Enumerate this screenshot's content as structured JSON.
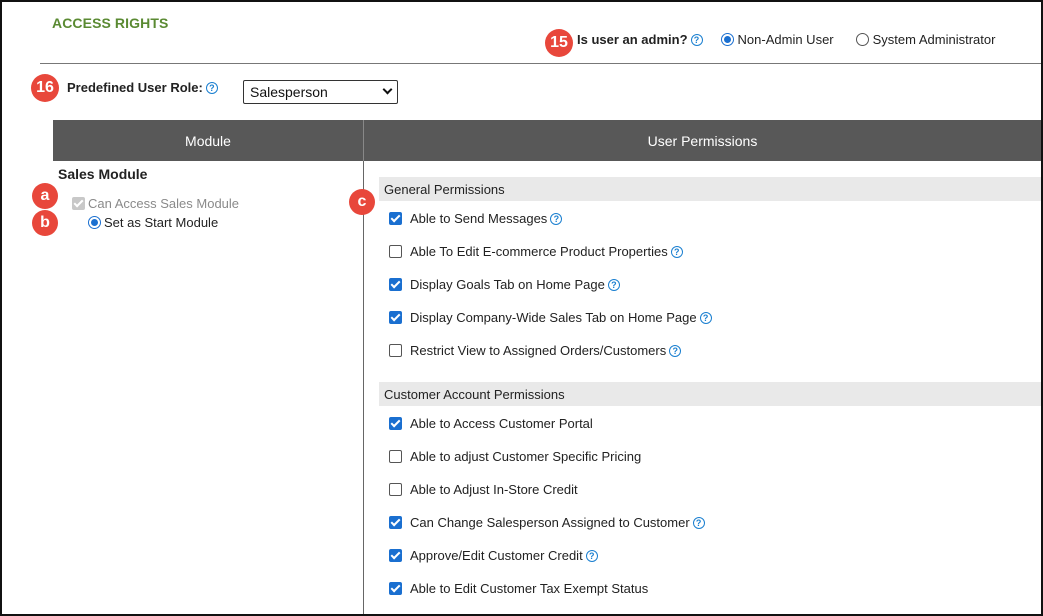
{
  "section_title": "ACCESS RIGHTS",
  "badges": {
    "admin": "15",
    "role": "16",
    "can_access": "a",
    "start_module": "b",
    "permissions": "c"
  },
  "admin": {
    "label": "Is user an admin?",
    "options": [
      {
        "label": "Non-Admin User",
        "selected": true
      },
      {
        "label": "System Administrator",
        "selected": false
      }
    ]
  },
  "role": {
    "label": "Predefined User Role:",
    "selected": "Salesperson"
  },
  "table": {
    "module_header": "Module",
    "permissions_header": "User Permissions"
  },
  "module": {
    "name": "Sales Module",
    "can_access": {
      "label": "Can Access Sales Module",
      "checked": true,
      "disabled": true
    },
    "start_module": {
      "label": "Set as Start Module",
      "selected": true
    }
  },
  "groups": [
    {
      "title": "General Permissions",
      "items": [
        {
          "label": "Able to Send Messages",
          "checked": true,
          "help": true
        },
        {
          "label": "Able To Edit E-commerce Product Properties",
          "checked": false,
          "help": true
        },
        {
          "label": "Display Goals Tab on Home Page",
          "checked": true,
          "help": true
        },
        {
          "label": "Display Company-Wide Sales Tab on Home Page",
          "checked": true,
          "help": true
        },
        {
          "label": "Restrict View to Assigned Orders/Customers",
          "checked": false,
          "help": true
        }
      ]
    },
    {
      "title": "Customer Account Permissions",
      "items": [
        {
          "label": "Able to Access Customer Portal",
          "checked": true,
          "help": false
        },
        {
          "label": "Able to adjust Customer Specific Pricing",
          "checked": false,
          "help": false
        },
        {
          "label": "Able to Adjust In-Store Credit",
          "checked": false,
          "help": false
        },
        {
          "label": "Can Change Salesperson Assigned to Customer",
          "checked": true,
          "help": true
        },
        {
          "label": "Approve/Edit Customer Credit",
          "checked": true,
          "help": true
        },
        {
          "label": "Able to Edit Customer Tax Exempt Status",
          "checked": true,
          "help": false
        }
      ]
    }
  ],
  "colors": {
    "accent_green": "#5a8a32",
    "badge_red": "#e8473b",
    "header_gray": "#585858",
    "link_blue": "#1a7fd0"
  }
}
